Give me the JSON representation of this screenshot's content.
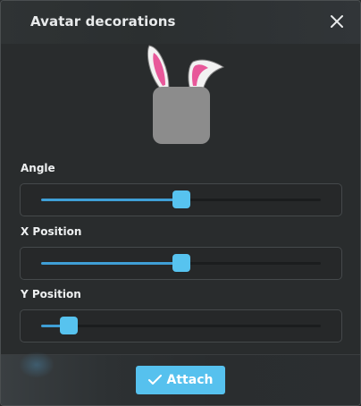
{
  "dialog": {
    "title": "Avatar decorations",
    "close_icon": "close-icon",
    "preview": {
      "decoration": "bunny-ears",
      "colors": {
        "ear_outer": "#f2f2f2",
        "ear_inner": "#e8589a",
        "ear_edge": "#8f8f8f",
        "avatar_fill": "#8c8c8c"
      }
    },
    "sliders": [
      {
        "label": "Angle",
        "value": 0.5
      },
      {
        "label": "X Position",
        "value": 0.5
      },
      {
        "label": "Y Position",
        "value": 0.1
      }
    ],
    "attach_button": {
      "label": "Attach",
      "icon": "check-icon"
    },
    "colors": {
      "accent": "#56c1ee",
      "track_fill": "#3f9fd6",
      "background": "#292c2d"
    }
  }
}
